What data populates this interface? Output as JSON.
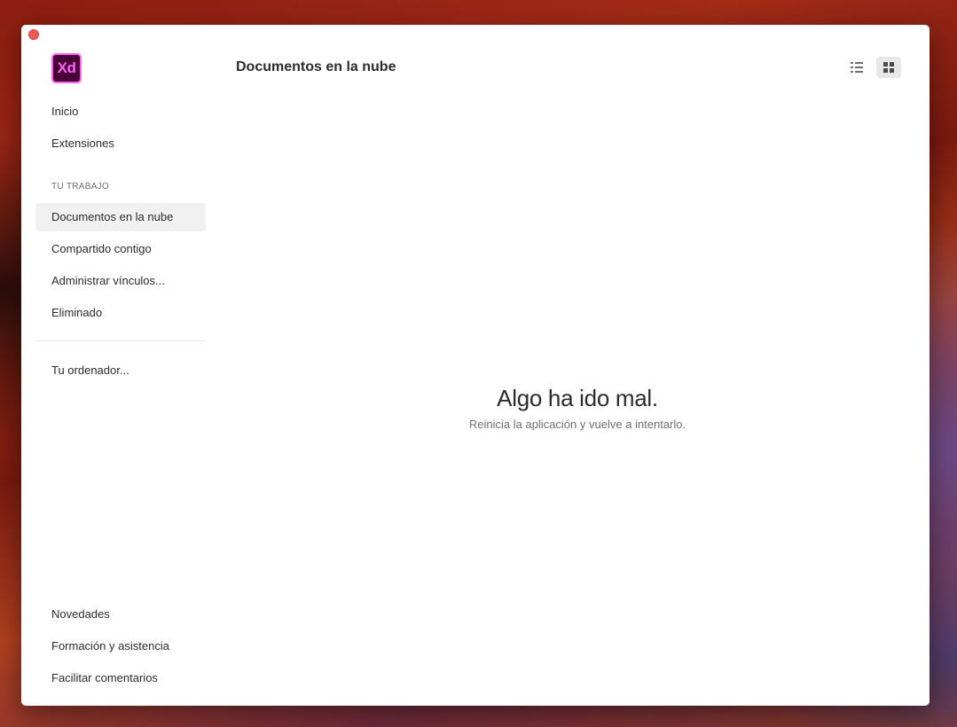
{
  "app": {
    "logo_text": "Xd",
    "logo_colors": {
      "background": "#470137",
      "accent": "#ff61f6"
    }
  },
  "sidebar": {
    "top_items": [
      {
        "label": "Inicio"
      },
      {
        "label": "Extensiones"
      }
    ],
    "section_label": "TU TRABAJO",
    "work_items": [
      {
        "label": "Documentos en la nube",
        "active": true
      },
      {
        "label": "Compartido contigo"
      },
      {
        "label": "Administrar vínculos..."
      },
      {
        "label": "Eliminado"
      }
    ],
    "local_item": {
      "label": "Tu ordenador..."
    },
    "bottom_items": [
      {
        "label": "Novedades"
      },
      {
        "label": "Formación y asistencia"
      },
      {
        "label": "Facilitar comentarios"
      }
    ]
  },
  "main": {
    "title": "Documentos en la nube",
    "view_toggle": {
      "list_icon": "list-view-icon",
      "grid_icon": "grid-view-icon",
      "selected": "grid"
    },
    "empty_state": {
      "title": "Algo ha ido mal.",
      "subtitle": "Reinicia la aplicación y vuelve a intentarlo."
    }
  },
  "colors": {
    "close_button": "#ee5b56",
    "active_item_bg": "#f1f1f1"
  }
}
